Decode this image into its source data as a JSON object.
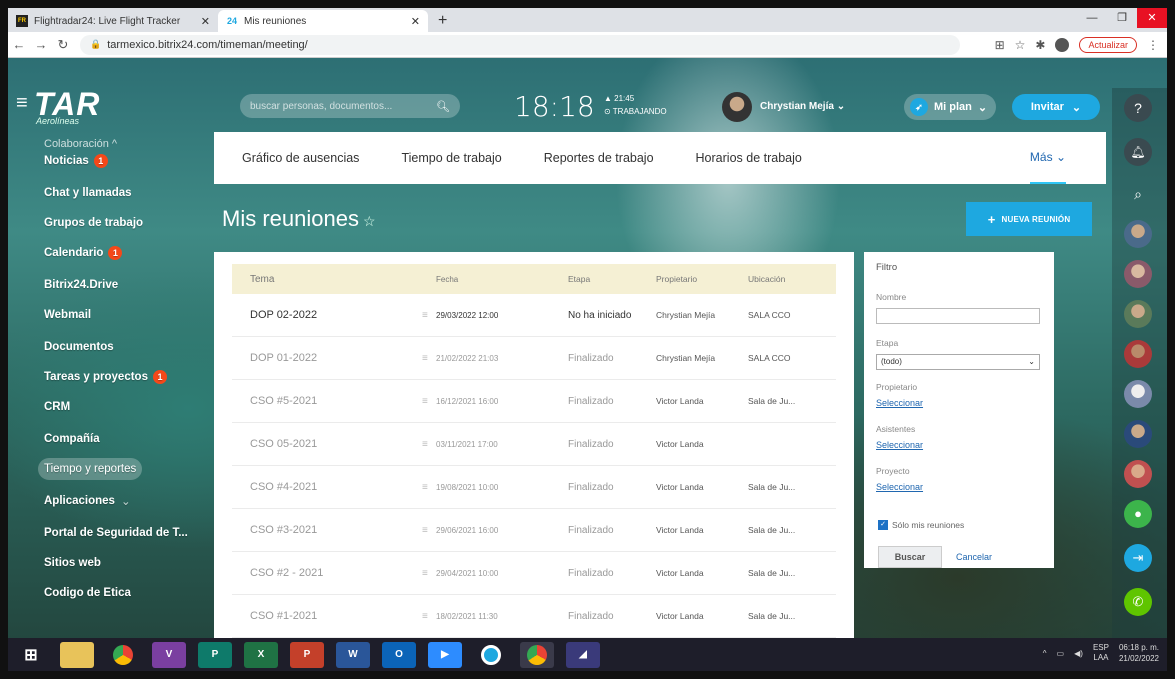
{
  "browser": {
    "tabs": [
      {
        "label": "Flightradar24: Live Flight Tracker",
        "favicon": "FR"
      },
      {
        "label": "Mis reuniones",
        "favicon": "24"
      }
    ],
    "new_tab": "+",
    "url": "tarmexico.bitrix24.com/timeman/meeting/",
    "update_button": "Actualizar"
  },
  "header": {
    "brand": "TAR",
    "brand_sub": "Aerolíneas",
    "search_placeholder": "buscar personas, documentos...",
    "clock_time": "18:18",
    "clock_extra_time": "21:45",
    "clock_status": "TRABAJANDO",
    "user_name": "Chrystian Mejía",
    "plan_label": "Mi plan",
    "invite_label": "Invitar"
  },
  "sidebar": {
    "section": "Colaboración",
    "items": [
      {
        "label": "Noticias",
        "badge": "1"
      },
      {
        "label": "Chat y llamadas",
        "badge": ""
      },
      {
        "label": "Grupos de trabajo",
        "badge": ""
      },
      {
        "label": "Calendario",
        "badge": "1"
      },
      {
        "label": "Bitrix24.Drive",
        "badge": ""
      },
      {
        "label": "Webmail",
        "badge": ""
      },
      {
        "label": "Documentos",
        "badge": ""
      },
      {
        "label": "Tareas y proyectos",
        "badge": "1"
      },
      {
        "label": "CRM",
        "badge": ""
      },
      {
        "label": "Compañía",
        "badge": ""
      },
      {
        "label": "Tiempo y reportes",
        "badge": ""
      },
      {
        "label": "Aplicaciones",
        "badge": ""
      },
      {
        "label": "Portal de Seguridad de T...",
        "badge": ""
      },
      {
        "label": "Sitios web",
        "badge": ""
      },
      {
        "label": "Codigo de Etica",
        "badge": ""
      }
    ]
  },
  "topnav": {
    "tabs": [
      "Gráfico de ausencias",
      "Tiempo de trabajo",
      "Reportes de trabajo",
      "Horarios de trabajo"
    ],
    "more": "Más"
  },
  "page": {
    "title": "Mis reuniones",
    "new_meeting": "NUEVA REUNIÓN"
  },
  "table": {
    "headers": [
      "Tema",
      "Fecha",
      "Etapa",
      "Propietario",
      "Ubicación"
    ],
    "rows": [
      {
        "tema": "DOP 02-2022",
        "fecha": "29/03/2022 12:00",
        "etapa": "No ha iniciado",
        "propietario": "Chrystian Mejía",
        "ubicacion": "SALA CCO"
      },
      {
        "tema": "DOP 01-2022",
        "fecha": "21/02/2022 21:03",
        "etapa": "Finalizado",
        "propietario": "Chrystian Mejía",
        "ubicacion": "SALA CCO"
      },
      {
        "tema": "CSO #5-2021",
        "fecha": "16/12/2021 16:00",
        "etapa": "Finalizado",
        "propietario": "Victor Landa",
        "ubicacion": "Sala de Ju..."
      },
      {
        "tema": "CSO 05-2021",
        "fecha": "03/11/2021 17:00",
        "etapa": "Finalizado",
        "propietario": "Victor Landa",
        "ubicacion": ""
      },
      {
        "tema": "CSO #4-2021",
        "fecha": "19/08/2021 10:00",
        "etapa": "Finalizado",
        "propietario": "Victor Landa",
        "ubicacion": "Sala de Ju..."
      },
      {
        "tema": "CSO #3-2021",
        "fecha": "29/06/2021 16:00",
        "etapa": "Finalizado",
        "propietario": "Victor Landa",
        "ubicacion": "Sala de Ju..."
      },
      {
        "tema": "CSO #2 - 2021",
        "fecha": "29/04/2021 10:00",
        "etapa": "Finalizado",
        "propietario": "Victor Landa",
        "ubicacion": "Sala de Ju..."
      },
      {
        "tema": "CSO #1-2021",
        "fecha": "18/02/2021 11:30",
        "etapa": "Finalizado",
        "propietario": "Victor Landa",
        "ubicacion": "Sala de Ju..."
      }
    ]
  },
  "filter": {
    "title": "Filtro",
    "name_label": "Nombre",
    "stage_label": "Etapa",
    "stage_value": "(todo)",
    "owner_label": "Propietario",
    "attendees_label": "Asistentes",
    "project_label": "Proyecto",
    "select_link": "Seleccionar",
    "only_mine": "Sólo mis reuniones",
    "search_button": "Buscar",
    "cancel_button": "Cancelar"
  },
  "taskbar": {
    "lang_top": "ESP",
    "lang_bottom": "LAA",
    "time": "06:18 p. m.",
    "date": "21/02/2022"
  },
  "colors": {
    "accent": "#1ea8e0",
    "badge": "#f54819",
    "link": "#2067b0"
  }
}
